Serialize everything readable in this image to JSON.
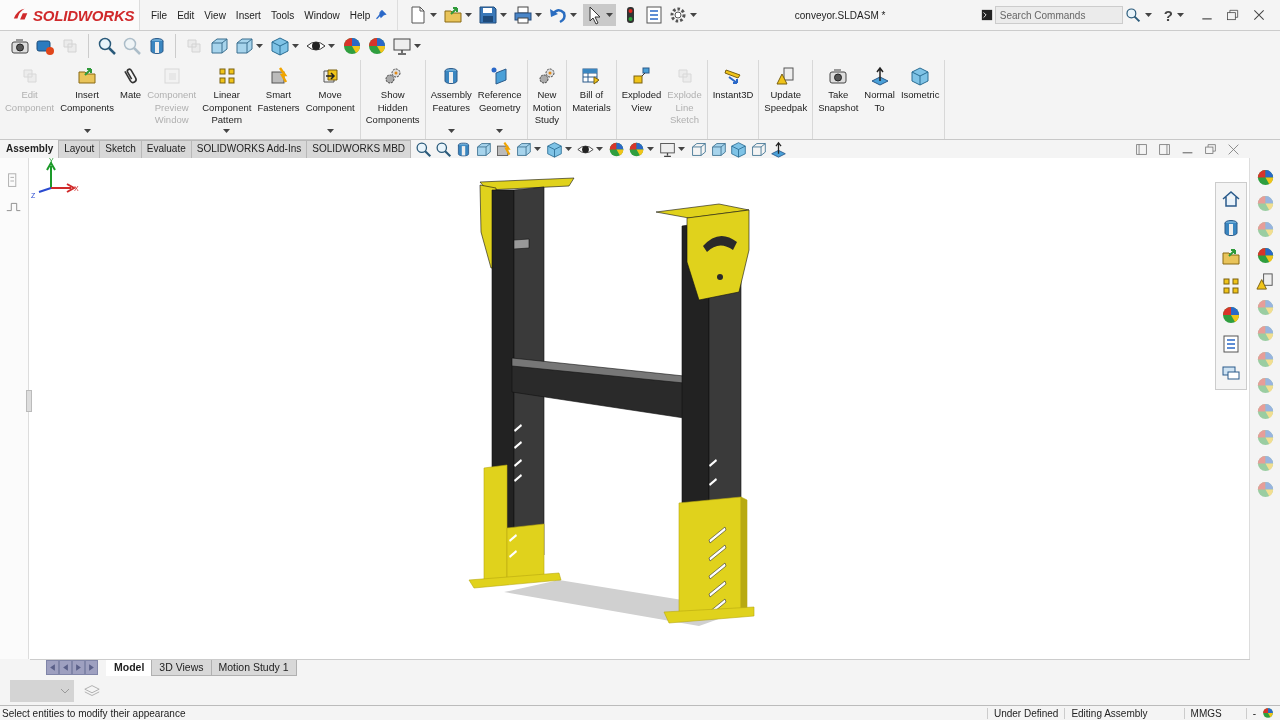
{
  "app": {
    "logo": "SOLIDWORKS",
    "menu": [
      "File",
      "Edit",
      "View",
      "Insert",
      "Tools",
      "Window",
      "Help"
    ],
    "document_title": "conveyor.SLDASM *",
    "search": {
      "placeholder": "Search Commands"
    },
    "help": "?"
  },
  "ribbon": {
    "groups": [
      {
        "items": [
          {
            "label": "Edit\nComponent",
            "disabled": true,
            "dropdown": false
          },
          {
            "label": "Insert\nComponents",
            "disabled": false,
            "dropdown": true
          },
          {
            "label": "Mate",
            "disabled": false,
            "dropdown": false
          },
          {
            "label": "Component\nPreview\nWindow",
            "disabled": true,
            "dropdown": false
          },
          {
            "label": "Linear\nComponent\nPattern",
            "disabled": false,
            "dropdown": true
          },
          {
            "label": "Smart\nFasteners",
            "disabled": false,
            "dropdown": false
          },
          {
            "label": "Move\nComponent",
            "disabled": false,
            "dropdown": true
          }
        ]
      },
      {
        "items": [
          {
            "label": "Show\nHidden\nComponents",
            "disabled": false,
            "dropdown": false
          }
        ]
      },
      {
        "items": [
          {
            "label": "Assembly\nFeatures",
            "disabled": false,
            "dropdown": true
          },
          {
            "label": "Reference\nGeometry",
            "disabled": false,
            "dropdown": true
          }
        ]
      },
      {
        "items": [
          {
            "label": "New\nMotion\nStudy",
            "disabled": false,
            "dropdown": false
          }
        ]
      },
      {
        "items": [
          {
            "label": "Bill of\nMaterials",
            "disabled": false,
            "dropdown": false
          }
        ]
      },
      {
        "items": [
          {
            "label": "Exploded\nView",
            "disabled": false,
            "dropdown": false
          },
          {
            "label": "Explode\nLine\nSketch",
            "disabled": true,
            "dropdown": false
          }
        ]
      },
      {
        "items": [
          {
            "label": "Instant3D",
            "disabled": false,
            "dropdown": false
          }
        ]
      },
      {
        "items": [
          {
            "label": "Update\nSpeedpak",
            "disabled": false,
            "dropdown": false
          }
        ]
      },
      {
        "items": [
          {
            "label": "Take\nSnapshot",
            "disabled": false,
            "dropdown": false
          },
          {
            "label": "Normal\nTo",
            "disabled": false,
            "dropdown": false
          },
          {
            "label": "Isometric",
            "disabled": false,
            "dropdown": false
          }
        ]
      }
    ]
  },
  "command_tabs": [
    {
      "label": "Assembly",
      "selected": true
    },
    {
      "label": "Layout",
      "selected": false
    },
    {
      "label": "Sketch",
      "selected": false
    },
    {
      "label": "Evaluate",
      "selected": false
    },
    {
      "label": "SOLIDWORKS Add-Ins",
      "selected": false
    },
    {
      "label": "SOLIDWORKS MBD",
      "selected": false
    }
  ],
  "viewport": {
    "triad": [
      "Y",
      "X",
      "Z"
    ]
  },
  "bottom_tabs": [
    {
      "label": "Model",
      "selected": true
    },
    {
      "label": "3D Views",
      "selected": false
    },
    {
      "label": "Motion Study 1",
      "selected": false
    }
  ],
  "status_bar": {
    "message": "Select entities to modify their appearance",
    "fields": [
      "Under Defined",
      "Editing Assembly",
      "MMGS",
      "-"
    ]
  }
}
